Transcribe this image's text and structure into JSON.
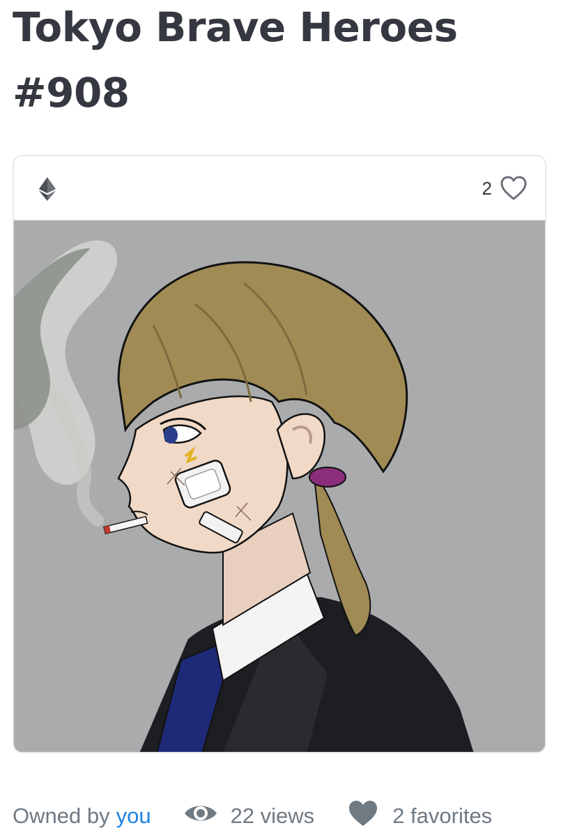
{
  "item": {
    "title": "Tokyo Brave Heroes #908"
  },
  "card": {
    "currency_icon": "ethereum-icon",
    "favorite_count": "2",
    "favorite_icon": "heart-outline-icon",
    "image_alt": "anime-style portrait: person with light-brown twin ponytails, bandaged cheek, cigarette, black suit and navy tie on grey background"
  },
  "meta": {
    "owned_by_label": "Owned by",
    "owner": "you",
    "views_icon": "eye-icon",
    "views": "22 views",
    "favorites_icon": "heart-icon",
    "favorites": "2 favorites"
  },
  "colors": {
    "text_dark": "#353840",
    "text_muted": "#707a83",
    "link": "#2081e2",
    "border": "#e5e8eb",
    "art_background": "#aaabad"
  }
}
